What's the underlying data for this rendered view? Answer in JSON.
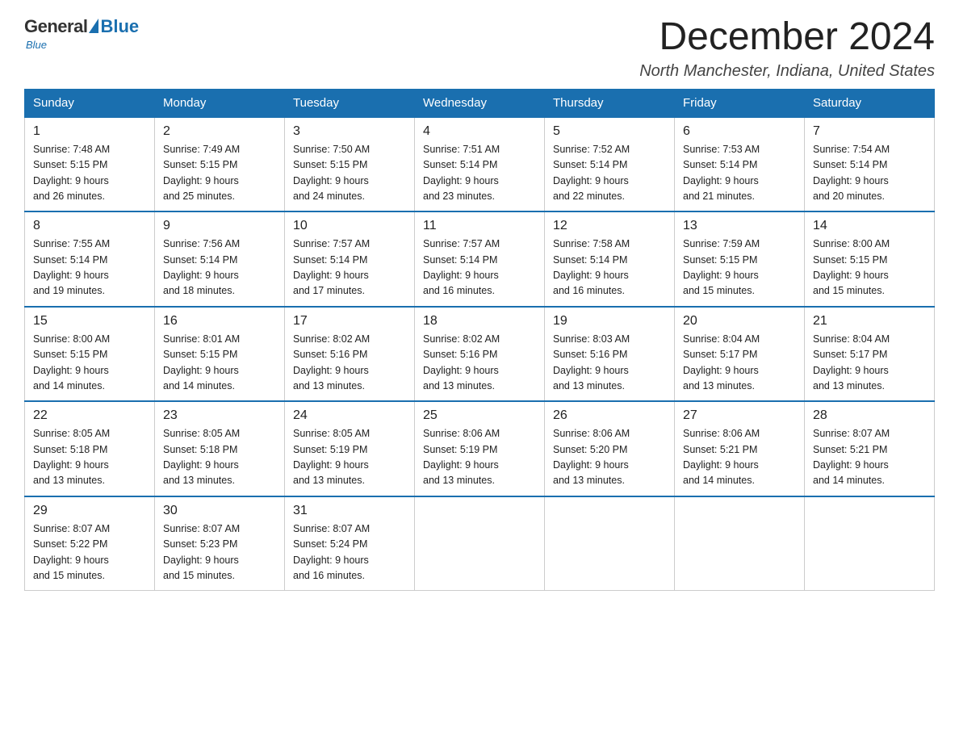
{
  "logo": {
    "general": "General",
    "blue": "Blue",
    "subtitle": "Blue"
  },
  "header": {
    "month": "December 2024",
    "location": "North Manchester, Indiana, United States"
  },
  "weekdays": [
    "Sunday",
    "Monday",
    "Tuesday",
    "Wednesday",
    "Thursday",
    "Friday",
    "Saturday"
  ],
  "weeks": [
    [
      {
        "day": "1",
        "sunrise": "7:48 AM",
        "sunset": "5:15 PM",
        "daylight": "9 hours and 26 minutes."
      },
      {
        "day": "2",
        "sunrise": "7:49 AM",
        "sunset": "5:15 PM",
        "daylight": "9 hours and 25 minutes."
      },
      {
        "day": "3",
        "sunrise": "7:50 AM",
        "sunset": "5:15 PM",
        "daylight": "9 hours and 24 minutes."
      },
      {
        "day": "4",
        "sunrise": "7:51 AM",
        "sunset": "5:14 PM",
        "daylight": "9 hours and 23 minutes."
      },
      {
        "day": "5",
        "sunrise": "7:52 AM",
        "sunset": "5:14 PM",
        "daylight": "9 hours and 22 minutes."
      },
      {
        "day": "6",
        "sunrise": "7:53 AM",
        "sunset": "5:14 PM",
        "daylight": "9 hours and 21 minutes."
      },
      {
        "day": "7",
        "sunrise": "7:54 AM",
        "sunset": "5:14 PM",
        "daylight": "9 hours and 20 minutes."
      }
    ],
    [
      {
        "day": "8",
        "sunrise": "7:55 AM",
        "sunset": "5:14 PM",
        "daylight": "9 hours and 19 minutes."
      },
      {
        "day": "9",
        "sunrise": "7:56 AM",
        "sunset": "5:14 PM",
        "daylight": "9 hours and 18 minutes."
      },
      {
        "day": "10",
        "sunrise": "7:57 AM",
        "sunset": "5:14 PM",
        "daylight": "9 hours and 17 minutes."
      },
      {
        "day": "11",
        "sunrise": "7:57 AM",
        "sunset": "5:14 PM",
        "daylight": "9 hours and 16 minutes."
      },
      {
        "day": "12",
        "sunrise": "7:58 AM",
        "sunset": "5:14 PM",
        "daylight": "9 hours and 16 minutes."
      },
      {
        "day": "13",
        "sunrise": "7:59 AM",
        "sunset": "5:15 PM",
        "daylight": "9 hours and 15 minutes."
      },
      {
        "day": "14",
        "sunrise": "8:00 AM",
        "sunset": "5:15 PM",
        "daylight": "9 hours and 15 minutes."
      }
    ],
    [
      {
        "day": "15",
        "sunrise": "8:00 AM",
        "sunset": "5:15 PM",
        "daylight": "9 hours and 14 minutes."
      },
      {
        "day": "16",
        "sunrise": "8:01 AM",
        "sunset": "5:15 PM",
        "daylight": "9 hours and 14 minutes."
      },
      {
        "day": "17",
        "sunrise": "8:02 AM",
        "sunset": "5:16 PM",
        "daylight": "9 hours and 13 minutes."
      },
      {
        "day": "18",
        "sunrise": "8:02 AM",
        "sunset": "5:16 PM",
        "daylight": "9 hours and 13 minutes."
      },
      {
        "day": "19",
        "sunrise": "8:03 AM",
        "sunset": "5:16 PM",
        "daylight": "9 hours and 13 minutes."
      },
      {
        "day": "20",
        "sunrise": "8:04 AM",
        "sunset": "5:17 PM",
        "daylight": "9 hours and 13 minutes."
      },
      {
        "day": "21",
        "sunrise": "8:04 AM",
        "sunset": "5:17 PM",
        "daylight": "9 hours and 13 minutes."
      }
    ],
    [
      {
        "day": "22",
        "sunrise": "8:05 AM",
        "sunset": "5:18 PM",
        "daylight": "9 hours and 13 minutes."
      },
      {
        "day": "23",
        "sunrise": "8:05 AM",
        "sunset": "5:18 PM",
        "daylight": "9 hours and 13 minutes."
      },
      {
        "day": "24",
        "sunrise": "8:05 AM",
        "sunset": "5:19 PM",
        "daylight": "9 hours and 13 minutes."
      },
      {
        "day": "25",
        "sunrise": "8:06 AM",
        "sunset": "5:19 PM",
        "daylight": "9 hours and 13 minutes."
      },
      {
        "day": "26",
        "sunrise": "8:06 AM",
        "sunset": "5:20 PM",
        "daylight": "9 hours and 13 minutes."
      },
      {
        "day": "27",
        "sunrise": "8:06 AM",
        "sunset": "5:21 PM",
        "daylight": "9 hours and 14 minutes."
      },
      {
        "day": "28",
        "sunrise": "8:07 AM",
        "sunset": "5:21 PM",
        "daylight": "9 hours and 14 minutes."
      }
    ],
    [
      {
        "day": "29",
        "sunrise": "8:07 AM",
        "sunset": "5:22 PM",
        "daylight": "9 hours and 15 minutes."
      },
      {
        "day": "30",
        "sunrise": "8:07 AM",
        "sunset": "5:23 PM",
        "daylight": "9 hours and 15 minutes."
      },
      {
        "day": "31",
        "sunrise": "8:07 AM",
        "sunset": "5:24 PM",
        "daylight": "9 hours and 16 minutes."
      },
      null,
      null,
      null,
      null
    ]
  ],
  "labels": {
    "sunrise": "Sunrise:",
    "sunset": "Sunset:",
    "daylight": "Daylight:"
  }
}
